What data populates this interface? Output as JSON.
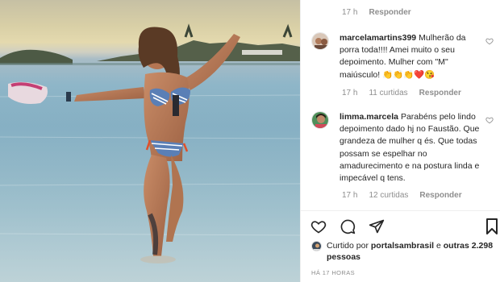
{
  "photo": {
    "alt_subject": "woman-in-striped-bikini-at-beach"
  },
  "top_comment_meta": {
    "time": "17 h",
    "reply": "Responder"
  },
  "comments": [
    {
      "username": "marcelamartins399",
      "text": "Mulherão da porra toda!!!! Amei muito o seu depoimento. Mulher com \"M\" maiúsculo! 👏👏👏❤️😘",
      "time": "17 h",
      "likes": "11 curtidas",
      "reply": "Responder"
    },
    {
      "username": "limma.marcela",
      "text": "Parabéns pelo lindo depoimento dado hj no Faustão. Que grandeza de mulher q és. Que todas possam se espelhar no amadurecimento e na postura linda e impecável q tens.",
      "time": "17 h",
      "likes": "12 curtidas",
      "reply": "Responder"
    }
  ],
  "liked_by": {
    "prefix": "Curtido por",
    "user": "portalsambrasil",
    "middle": "e",
    "others": "outras 2.298 pessoas"
  },
  "post_date": "HÁ 17 HORAS",
  "colors": {
    "text": "#262626",
    "muted": "#8e8e8e",
    "divider": "#efefef"
  },
  "icons": [
    "heart-icon",
    "comment-icon",
    "share-icon",
    "bookmark-icon"
  ]
}
